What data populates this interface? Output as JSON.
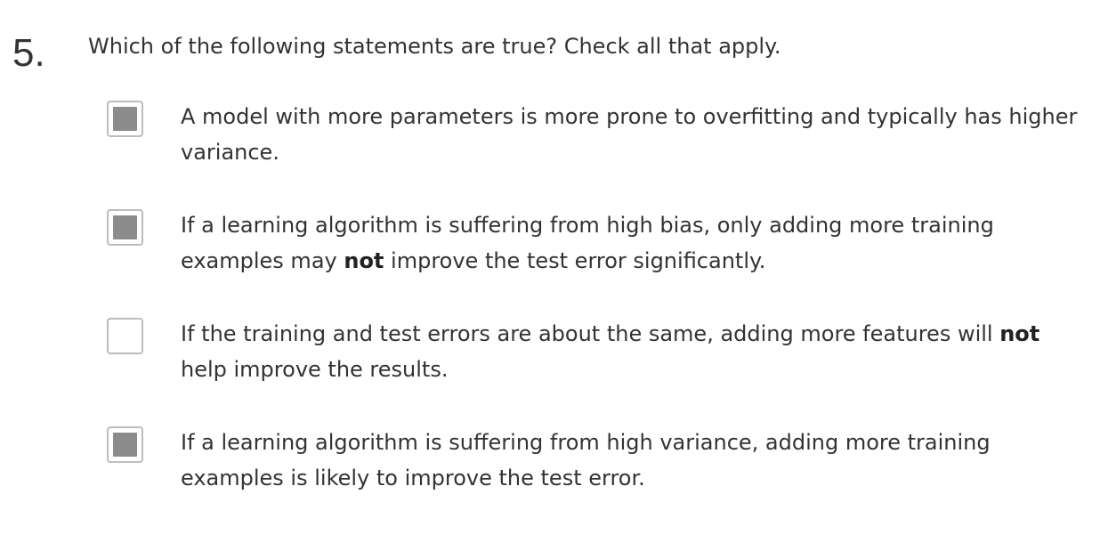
{
  "question": {
    "number": "5.",
    "text": "Which of the following statements are true? Check all that apply."
  },
  "options": [
    {
      "checked": true,
      "parts": [
        "A model with more parameters is more prone to overfitting and typically has higher variance."
      ]
    },
    {
      "checked": true,
      "parts": [
        "If a learning algorithm is suffering from high bias, only adding more training examples may ",
        "not",
        " improve the test error significantly."
      ]
    },
    {
      "checked": false,
      "parts": [
        "If the training and test errors are about the same, adding more features will ",
        "not",
        " help improve the results."
      ]
    },
    {
      "checked": true,
      "parts": [
        "If a learning algorithm is suffering from high variance, adding more training examples is likely to improve the test error."
      ]
    }
  ],
  "colors": {
    "text": "#333333",
    "checkbox_border": "#bdbdbd",
    "checkbox_fill": "#8c8c8c"
  }
}
